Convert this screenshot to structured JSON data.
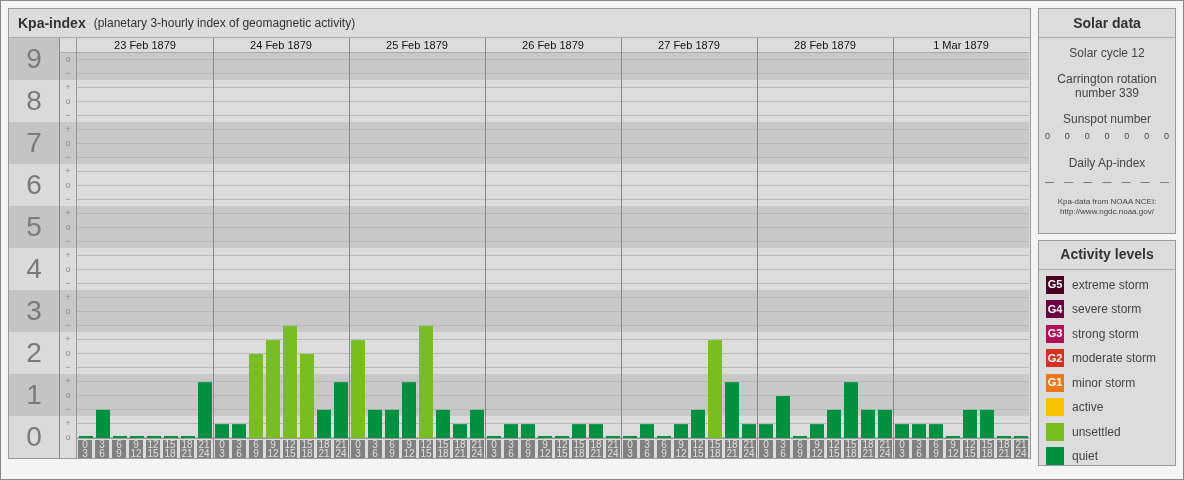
{
  "main": {
    "title": "Kpa-index",
    "subtitle": "(planetary 3-hourly index of geomagnetic activity)",
    "days": [
      "23 Feb 1879",
      "24 Feb 1879",
      "25 Feb 1879",
      "26 Feb 1879",
      "27 Feb 1879",
      "28 Feb 1879",
      "1 Mar 1879"
    ],
    "sub_marks": [
      "o",
      "−",
      "+",
      "o",
      "−",
      "+",
      "o",
      "−",
      "+",
      "o",
      "−",
      "+",
      "o",
      "−",
      "+",
      "o",
      "−",
      "+",
      "o",
      "−",
      "+",
      "o",
      "−",
      "+",
      "o",
      "−",
      "+",
      "o"
    ],
    "chart_data": {
      "type": "bar",
      "stacked": true,
      "grid": true,
      "ylim": [
        0,
        9.17
      ],
      "yticks": [
        9,
        8,
        7,
        6,
        5,
        4,
        3,
        2,
        1,
        0
      ],
      "categories": [
        "0 3",
        "3 6",
        "6 9",
        "9 12",
        "12 15",
        "15 18",
        "18 21",
        "21 24",
        "0 3",
        "3 6",
        "6 9",
        "9 12",
        "12 15",
        "15 18",
        "18 21",
        "21 24",
        "0 3",
        "3 6",
        "6 9",
        "9 12",
        "12 15",
        "15 18",
        "18 21",
        "21 24",
        "0 3",
        "3 6",
        "6 9",
        "9 12",
        "12 15",
        "15 18",
        "18 21",
        "21 24",
        "0 3",
        "3 6",
        "6 9",
        "9 12",
        "12 15",
        "15 18",
        "18 21",
        "21 24",
        "0 3",
        "3 6",
        "6 9",
        "9 12",
        "12 15",
        "15 18",
        "18 21",
        "21 24",
        "0 3",
        "3 6",
        "6 9",
        "9 12",
        "12 15",
        "15 18",
        "18 21",
        "21 24"
      ],
      "series": [
        {
          "color": "#009040",
          "values": [
            0,
            0.67,
            0,
            0,
            0,
            0,
            0,
            1.33,
            0.33,
            0.33,
            null,
            null,
            null,
            null,
            0.67,
            1.33,
            null,
            0.67,
            0.67,
            1.33,
            null,
            0.67,
            0.33,
            0.67,
            0,
            0.33,
            0.33,
            0,
            0,
            0.33,
            0.33,
            0,
            0,
            0.33,
            0,
            0.33,
            0.67,
            null,
            1.33,
            0.33,
            0.33,
            1,
            0,
            0.33,
            0.67,
            1.33,
            0.67,
            0.67,
            0.33,
            0.33,
            0.33,
            0,
            0.67,
            0.67,
            0,
            0
          ]
        },
        {
          "color": "#78be20",
          "values": [
            null,
            null,
            null,
            null,
            null,
            null,
            null,
            null,
            null,
            null,
            2,
            2.33,
            2.67,
            2,
            null,
            null,
            2.33,
            null,
            null,
            null,
            2.67,
            null,
            null,
            null,
            null,
            null,
            null,
            null,
            null,
            null,
            null,
            null,
            null,
            null,
            null,
            null,
            null,
            2.33,
            null,
            null,
            null,
            null,
            null,
            null,
            null,
            null,
            null,
            null,
            null,
            null,
            null,
            null,
            null,
            null,
            null,
            null
          ]
        }
      ]
    }
  },
  "solar": {
    "title": "Solar data",
    "cycle": "Solar cycle 12",
    "rotation": "Carrington rotation number 339",
    "sunspot_label": "Sunspot number",
    "sunspot_values": [
      "0",
      "0",
      "0",
      "0",
      "0",
      "0",
      "0"
    ],
    "ap_label": "Daily Ap-index",
    "ap_values": [
      "—",
      "—",
      "—",
      "—",
      "—",
      "—",
      "—"
    ],
    "source": "Kpa-data from NOAA NCEI:",
    "source_url": "http://www.ngdc.noaa.gov/"
  },
  "legend": {
    "title": "Activity levels",
    "items": [
      {
        "badge": "G5",
        "label": "extreme storm",
        "color": "#4a0022"
      },
      {
        "badge": "G4",
        "label": "severe storm",
        "color": "#6b0042"
      },
      {
        "badge": "G3",
        "label": "strong storm",
        "color": "#b0105a"
      },
      {
        "badge": "G2",
        "label": "moderate storm",
        "color": "#d83020"
      },
      {
        "badge": "G1",
        "label": "minor storm",
        "color": "#e87818"
      },
      {
        "label": "active",
        "color": "#f8c000"
      },
      {
        "label": "unsettled",
        "color": "#78be20"
      },
      {
        "label": "quiet",
        "color": "#009040"
      }
    ]
  }
}
